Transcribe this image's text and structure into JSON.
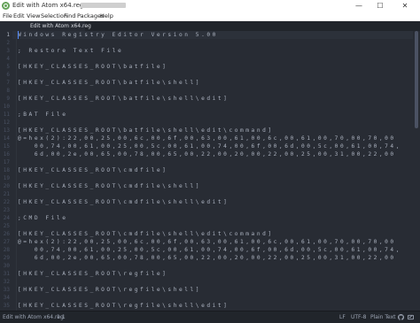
{
  "window": {
    "title": "Edit with Atom x64.reg",
    "controls": {
      "minimize": "—",
      "maximize": "☐",
      "close": "✕"
    }
  },
  "menu": {
    "file": "File",
    "edit": "Edit",
    "view": "View",
    "selection": "Selection",
    "find": "Find",
    "packages": "Packages",
    "help": "Help"
  },
  "tab": {
    "label": "Edit with Atom x64.reg"
  },
  "editor": {
    "current_line": 1,
    "line_numbers": [
      "1",
      "2",
      "3",
      "4",
      "5",
      "6",
      "7",
      "8",
      "9",
      "10",
      "11",
      "12",
      "13",
      "14",
      "15",
      "16",
      "17",
      "18",
      "19",
      "20",
      "21",
      "22",
      "23",
      "24",
      "25",
      "26",
      "27",
      "28",
      "29",
      "30",
      "31",
      "32",
      "33",
      "34",
      "35"
    ],
    "lines": [
      "Windows Registry Editor Version 5.00",
      "",
      "; Restore Text File",
      "",
      "[HKEY_CLASSES_ROOT\\batfile]",
      "",
      "[HKEY_CLASSES_ROOT\\batfile\\shell]",
      "",
      "[HKEY_CLASSES_ROOT\\batfile\\shell\\edit]",
      "",
      ";BAT File",
      "",
      "[HKEY_CLASSES_ROOT\\batfile\\shell\\edit\\command]",
      "@=hex(2):22,00,25,00,6c,00,6f,00,63,00,61,00,6c,00,61,00,70,00,70,00",
      "   00,74,00,61,00,25,00,5c,00,61,00,74,00,6f,00,6d,00,5c,00,61,00,74,",
      "   6d,00,2e,00,65,00,78,00,65,00,22,00,20,00,22,00,25,00,31,00,22,00",
      "",
      "[HKEY_CLASSES_ROOT\\cmdfile]",
      "",
      "[HKEY_CLASSES_ROOT\\cmdfile\\shell]",
      "",
      "[HKEY_CLASSES_ROOT\\cmdfile\\shell\\edit]",
      "",
      ";CMD File",
      "",
      "[HKEY_CLASSES_ROOT\\cmdfile\\shell\\edit\\command]",
      "@=hex(2):22,00,25,00,6c,00,6f,00,63,00,61,00,6c,00,61,00,70,00,70,00",
      "   00,74,00,61,00,25,00,5c,00,61,00,74,00,6f,00,6d,00,5c,00,61,00,74,",
      "   6d,00,2e,00,65,00,78,00,65,00,22,00,20,00,22,00,25,00,31,00,22,00",
      "",
      "[HKEY_CLASSES_ROOT\\regfile]",
      "",
      "[HKEY_CLASSES_ROOT\\regfile\\shell]",
      "",
      "[HKEY_CLASSES_ROOT\\regfile\\shell\\edit]"
    ]
  },
  "status": {
    "file": "Edit with Atom x64.reg",
    "cursor_position": "1:1",
    "line_ending": "LF",
    "encoding": "UTF-8",
    "grammar": "Plain Text",
    "github_icon": "github-icon",
    "git_icon": "git-icon"
  },
  "colors": {
    "editor_bg": "#282c34",
    "text": "#abb2bf",
    "cursor": "#528bff",
    "chrome_bg": "#21252b"
  }
}
